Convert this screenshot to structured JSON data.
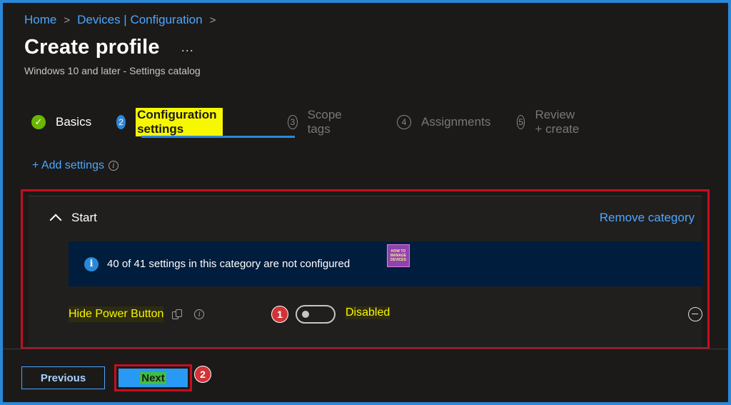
{
  "breadcrumb": {
    "items": [
      "Home",
      "Devices | Configuration"
    ],
    "separator": ">"
  },
  "header": {
    "title": "Create profile",
    "more": "...",
    "subtitle": "Windows 10 and later - Settings catalog"
  },
  "steps": [
    {
      "num": "✓",
      "label": "Basics",
      "state": "done"
    },
    {
      "num": "2",
      "label": "Configuration settings",
      "state": "current"
    },
    {
      "num": "3",
      "label": "Scope tags",
      "state": "todo"
    },
    {
      "num": "4",
      "label": "Assignments",
      "state": "todo"
    },
    {
      "num": "5",
      "label": "Review + create",
      "state": "todo"
    }
  ],
  "add_settings": {
    "label": "+ Add settings",
    "info": "i"
  },
  "category": {
    "name": "Start",
    "remove_label": "Remove category",
    "banner": {
      "info": "i",
      "text": "40 of 41 settings in this category are not configured",
      "logo_lines": [
        "HOW TO",
        "MANAGE",
        "DEVICES"
      ]
    },
    "setting": {
      "name": "Hide Power Button",
      "info": "i",
      "toggle_state": "Disabled",
      "toggle_on": false
    }
  },
  "annotations": {
    "one": "1",
    "two": "2"
  },
  "footer": {
    "previous": "Previous",
    "next": "Next"
  },
  "colors": {
    "accent": "#2b88d8",
    "link": "#4da6ff",
    "highlight_box": "#c50f1f",
    "done": "#6bb700"
  }
}
